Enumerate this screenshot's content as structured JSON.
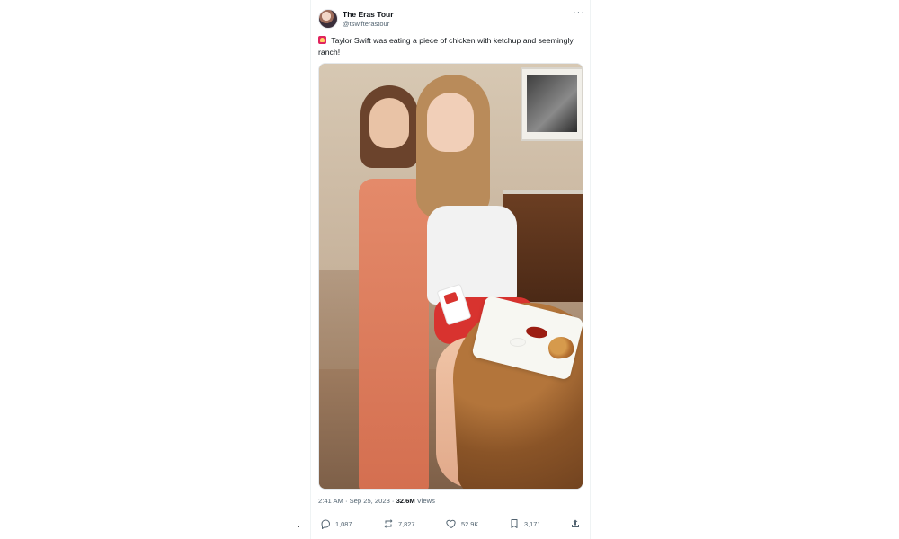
{
  "tweet": {
    "author_name": "The Eras Tour",
    "author_handle": "@tswifterastour",
    "text": "Taylor Swift was eating a piece of chicken with ketchup and seemingly ranch!",
    "timestamp": "2:41 AM · Sep 25, 2023",
    "views_count": "32.6M",
    "views_label": "Views"
  },
  "actions": {
    "replies": "1,087",
    "retweets": "7,827",
    "likes": "52.9K",
    "bookmarks": "3,171"
  },
  "icons": {
    "alert": "rotating-light-icon",
    "more": "more-options-icon",
    "reply": "reply-icon",
    "retweet": "retweet-icon",
    "like": "heart-icon",
    "bookmark": "bookmark-icon",
    "share": "share-icon"
  },
  "colors": {
    "text_primary": "#0f1419",
    "text_secondary": "#536471",
    "divider": "#eff3f4"
  }
}
